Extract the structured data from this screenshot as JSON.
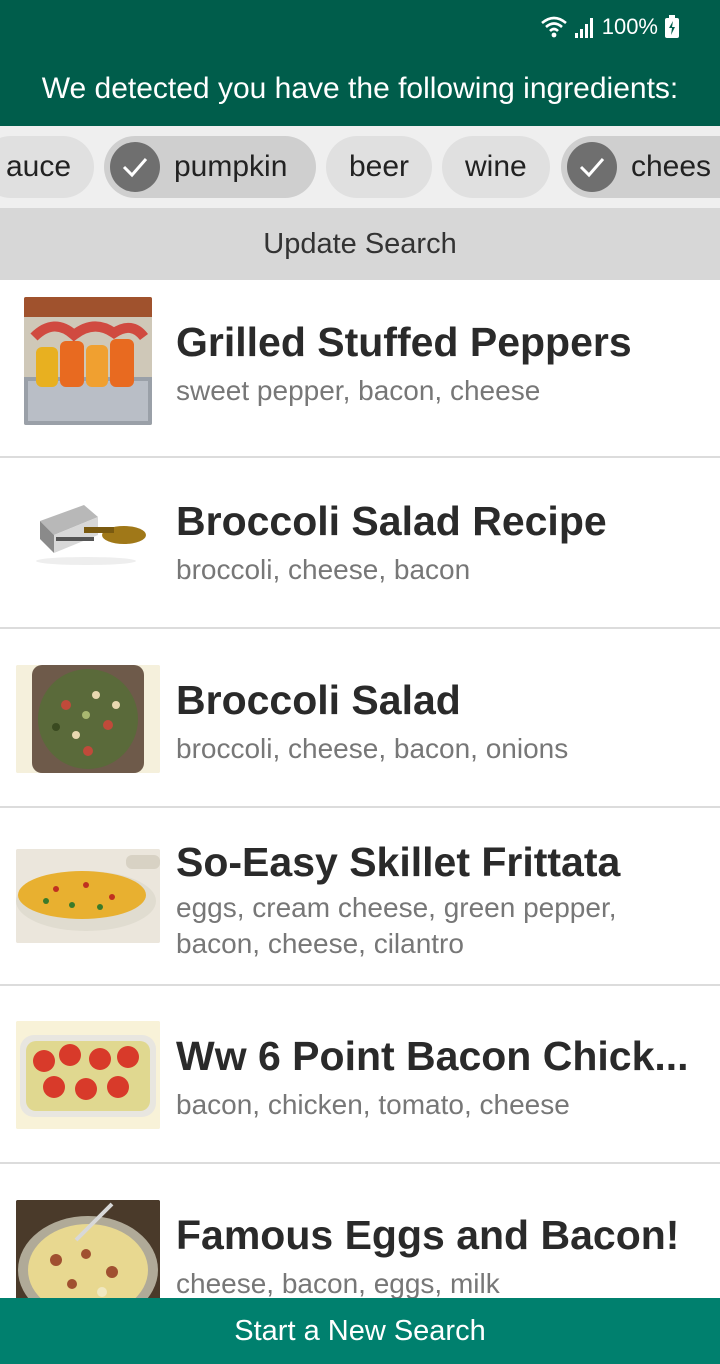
{
  "status": {
    "battery": "100%",
    "icons": [
      "wifi-icon",
      "signal-icon",
      "battery-charging-icon"
    ]
  },
  "header": {
    "title": "We detected you have the following ingredients:"
  },
  "chips": [
    {
      "label": "auce",
      "selected": false
    },
    {
      "label": "pumpkin",
      "selected": true
    },
    {
      "label": "beer",
      "selected": false
    },
    {
      "label": "wine",
      "selected": false
    },
    {
      "label": "chees",
      "selected": true
    }
  ],
  "update_label": "Update Search",
  "recipes": [
    {
      "title": "Grilled Stuffed Peppers",
      "ingredients": "sweet pepper, bacon, cheese"
    },
    {
      "title": "Broccoli Salad Recipe",
      "ingredients": "broccoli, cheese, bacon"
    },
    {
      "title": "Broccoli Salad",
      "ingredients": "broccoli, cheese, bacon, onions"
    },
    {
      "title": "So-Easy Skillet Frittata",
      "ingredients": "eggs, cream cheese, green pepper, bacon, cheese, cilantro"
    },
    {
      "title": "Ww 6 Point Bacon Chick...",
      "ingredients": "bacon, chicken, tomato, cheese"
    },
    {
      "title": "Famous Eggs and Bacon!",
      "ingredients": "cheese, bacon, eggs, milk"
    }
  ],
  "new_search_label": "Start a New Search",
  "colors": {
    "header": "#005d4b",
    "bottom_bar": "#00806e",
    "chip": "#e0e0e0",
    "chip_check": "#6f6f6f"
  }
}
